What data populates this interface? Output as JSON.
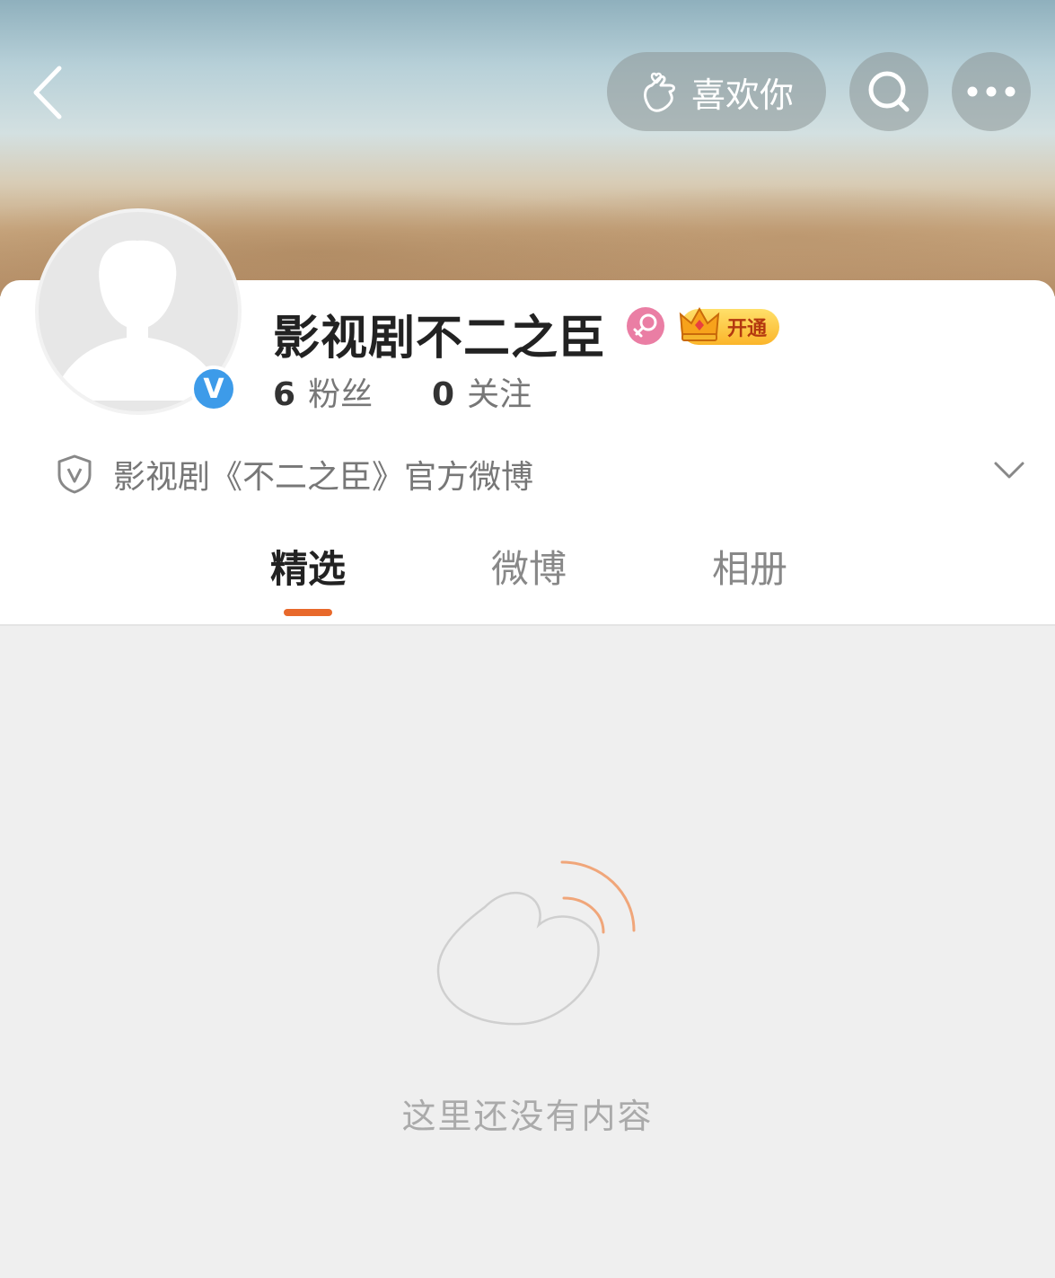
{
  "header": {
    "back_icon": "chevron-left-icon",
    "like_label": "喜欢你",
    "like_icon": "hand-heart-icon",
    "search_icon": "search-icon",
    "more_icon": "more-dots-icon"
  },
  "profile": {
    "name": "影视剧不二之臣",
    "verified_badge": "V",
    "gender_icon": "female-icon",
    "vip_label": "开通",
    "fans_count": "6",
    "fans_label": "粉丝",
    "following_count": "0",
    "following_label": "关注",
    "verification_text": "影视剧《不二之臣》官方微博"
  },
  "tabs": [
    {
      "label": "精选",
      "active": true
    },
    {
      "label": "微博",
      "active": false
    },
    {
      "label": "相册",
      "active": false
    }
  ],
  "empty_state": {
    "message": "这里还没有内容"
  },
  "colors": {
    "accent": "#e8692b",
    "verified_blue": "#3d9be9",
    "gender_pink": "#ea7ea4"
  }
}
